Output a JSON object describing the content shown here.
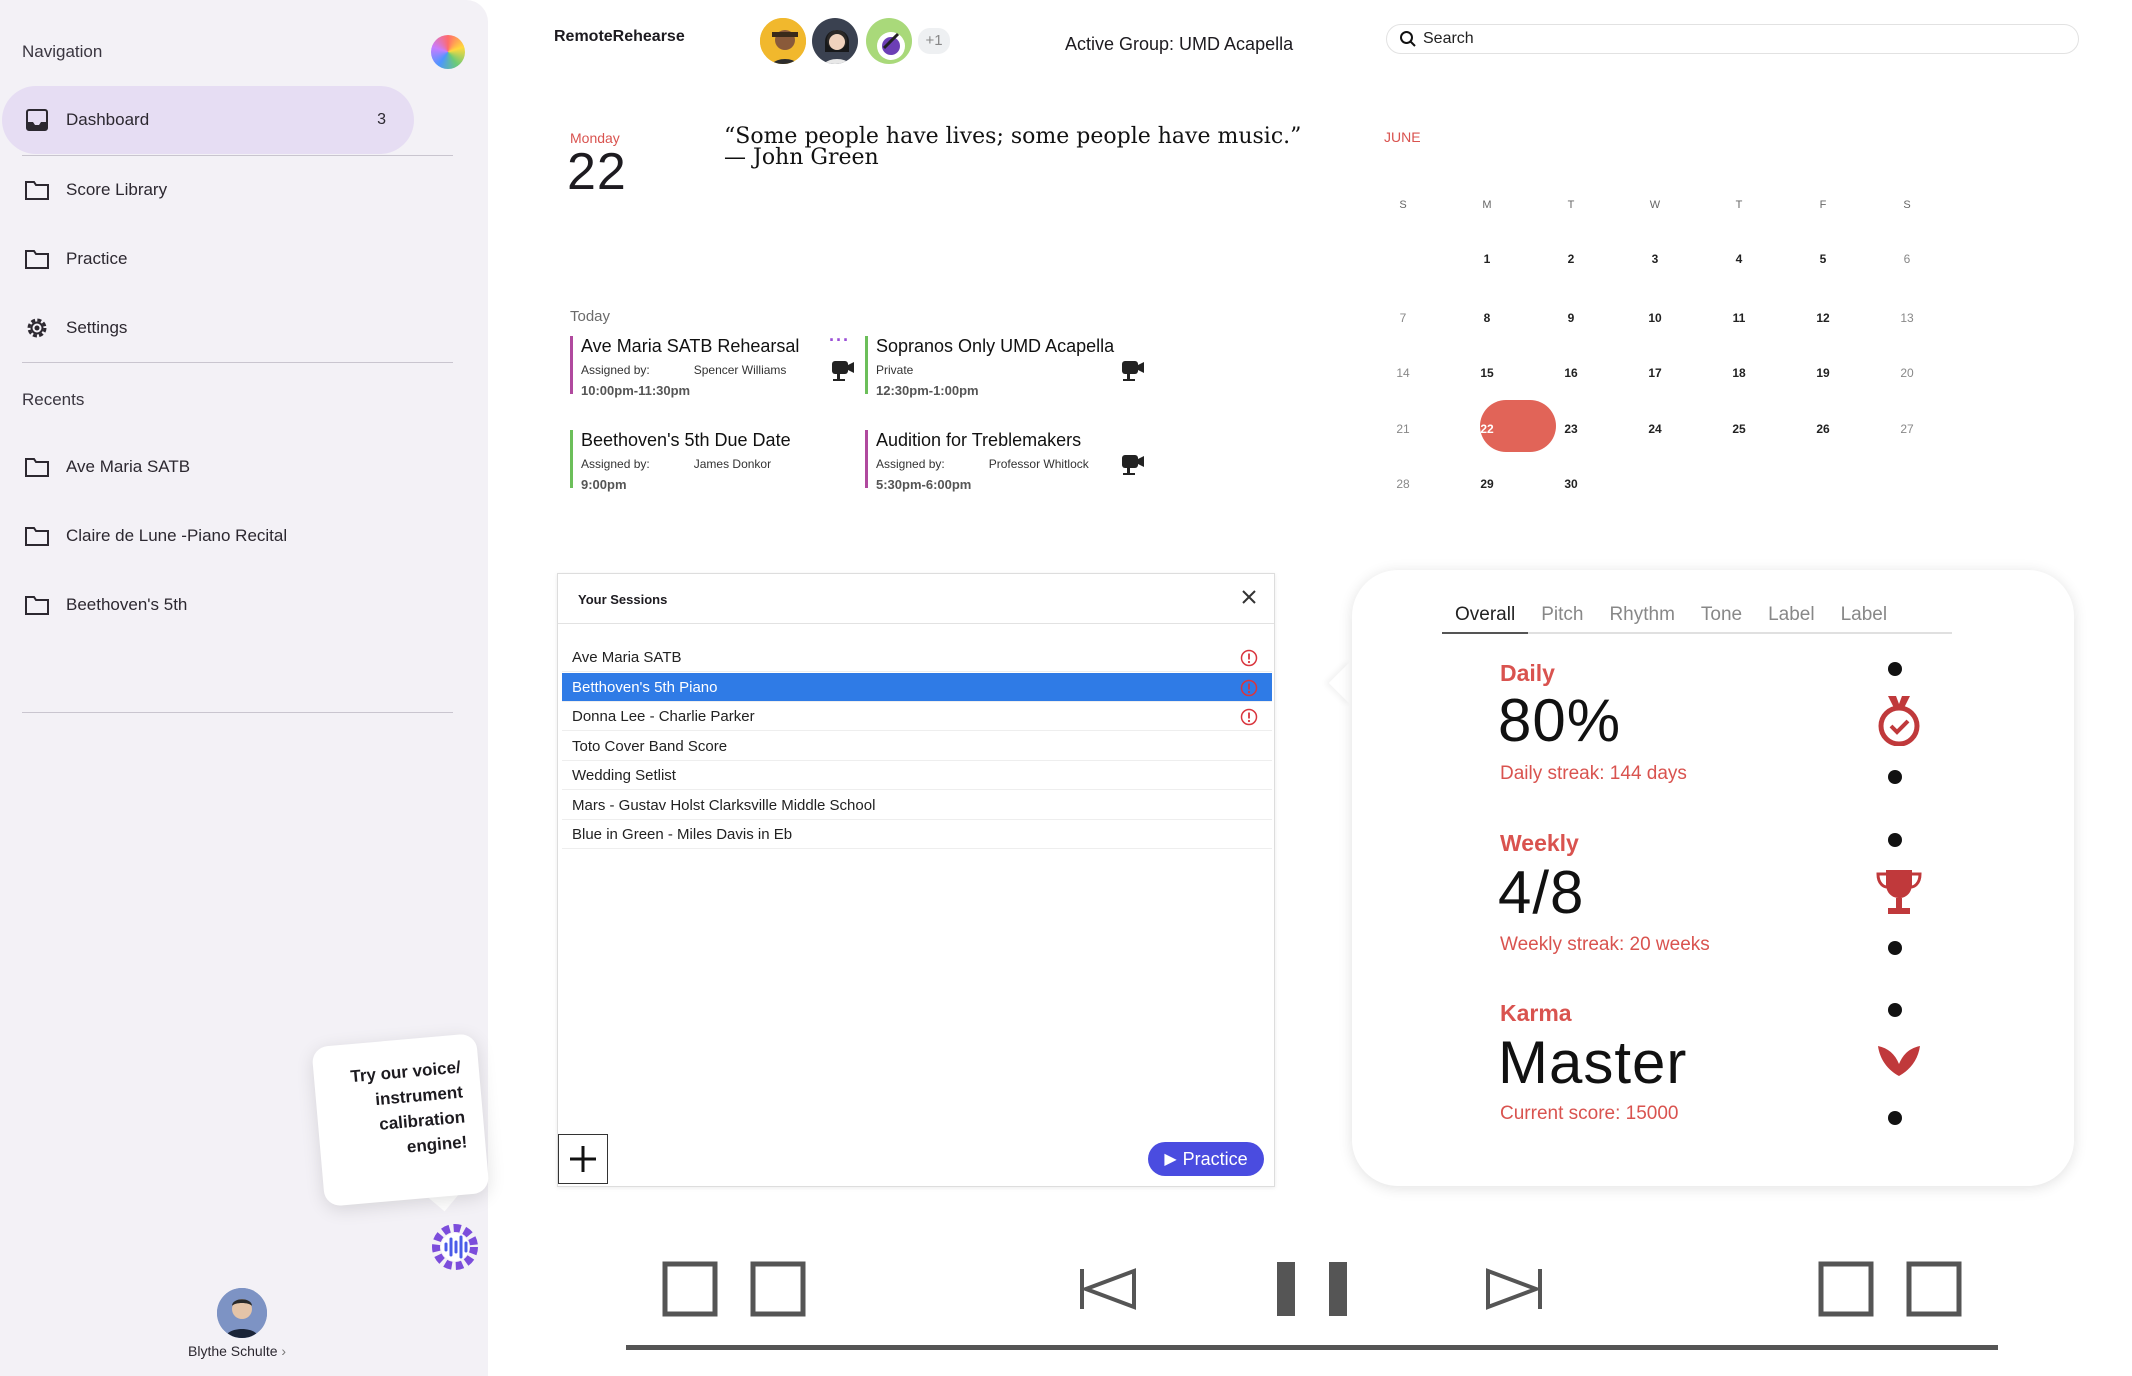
{
  "sidebar": {
    "title": "Navigation",
    "items": [
      {
        "label": "Dashboard",
        "badge": "3"
      },
      {
        "label": "Score Library"
      },
      {
        "label": "Practice"
      },
      {
        "label": "Settings"
      }
    ],
    "recents_title": "Recents",
    "recents": [
      {
        "label": "Ave Maria SATB"
      },
      {
        "label": "Claire de Lune -Piano Recital"
      },
      {
        "label": "Beethoven's 5th"
      }
    ],
    "promo": "Try our voice/ instrument calibration engine!",
    "user_name": "Blythe Schulte"
  },
  "header": {
    "brand": "RemoteRehearse",
    "extra_members": "+1",
    "active_group": "Active Group: UMD Acapella",
    "search_placeholder": "Search"
  },
  "date": {
    "weekday": "Monday",
    "day": "22"
  },
  "quote": {
    "text": "“Some people have lives; some people have music.”",
    "author": "— John Green"
  },
  "today": {
    "label": "Today",
    "events": [
      {
        "title": "Ave Maria SATB Rehearsal",
        "meta": "Assigned by:",
        "who": "Spencer Williams",
        "time": "10:00pm-11:30pm",
        "color": "#b0499e"
      },
      {
        "title": "Sopranos Only UMD Acapella",
        "meta": "Private",
        "who": "",
        "time": "12:30pm-1:00pm",
        "color": "#6cbf5a"
      },
      {
        "title": "Beethoven's 5th Due Date",
        "meta": "Assigned by:",
        "who": "James Donkor",
        "time": "9:00pm",
        "color": "#6cbf5a"
      },
      {
        "title": "Audition for Treblemakers",
        "meta": "Assigned by:",
        "who": "Professor Whitlock",
        "time": "5:30pm-6:00pm",
        "color": "#b0499e"
      }
    ]
  },
  "calendar": {
    "month": "JUNE",
    "weekdays": [
      "S",
      "M",
      "T",
      "W",
      "T",
      "F",
      "S"
    ],
    "weeks": [
      [
        "",
        "1",
        "2",
        "3",
        "4",
        "5",
        "6"
      ],
      [
        "7",
        "8",
        "9",
        "10",
        "11",
        "12",
        "13"
      ],
      [
        "14",
        "15",
        "16",
        "17",
        "18",
        "19",
        "20"
      ],
      [
        "21",
        "22",
        "23",
        "24",
        "25",
        "26",
        "27"
      ],
      [
        "28",
        "29",
        "30",
        "",
        "",
        "",
        ""
      ]
    ],
    "selected": "22",
    "selected_color": "#e16458"
  },
  "sessions": {
    "title": "Your Sessions",
    "items": [
      {
        "label": "Ave Maria SATB",
        "alert": true
      },
      {
        "label": "Betthoven's 5th Piano",
        "alert": true,
        "selected": true
      },
      {
        "label": "Donna Lee - Charlie Parker",
        "alert": true
      },
      {
        "label": "Toto Cover Band Score"
      },
      {
        "label": "Wedding Setlist"
      },
      {
        "label": "Mars - Gustav Holst Clarksville Middle School"
      },
      {
        "label": "Blue in Green - Miles Davis in Eb"
      }
    ],
    "practice_label": "Practice"
  },
  "stats": {
    "tabs": [
      "Overall",
      "Pitch",
      "Rhythm",
      "Tone",
      "Label",
      "Label"
    ],
    "active_tab": "Overall",
    "daily": {
      "label": "Daily",
      "value": "80%",
      "sub": "Daily streak: 144 days"
    },
    "weekly": {
      "label": "Weekly",
      "value": "4/8",
      "sub": "Weekly streak: 20 weeks"
    },
    "karma": {
      "label": "Karma",
      "value": "Master",
      "sub": "Current score: 15000"
    },
    "accent": "#d9534f"
  },
  "player": {
    "icons": [
      "square-icon",
      "square-icon",
      "skip-back-icon",
      "pause-icon",
      "skip-forward-icon",
      "square-icon",
      "square-icon"
    ]
  }
}
